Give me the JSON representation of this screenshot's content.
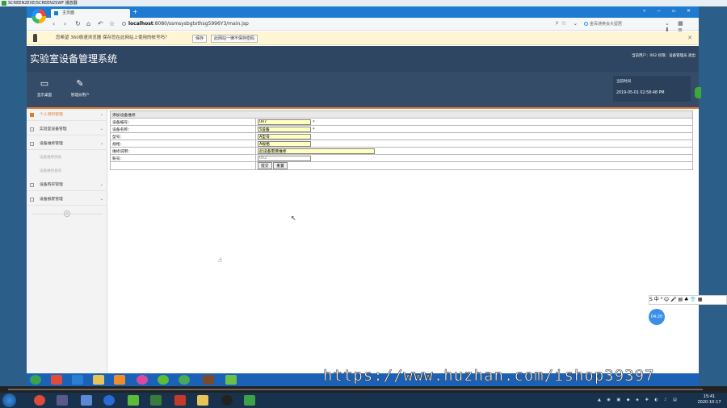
{
  "player": {
    "title": "SCREEN2EXE/SCREEN2SWF 播放器"
  },
  "browser": {
    "tab_title": "主页面",
    "new_tab": "+",
    "url_host": "localhost",
    "url_path": ":8080/ssmsysbgtxthsg5996Y3/main.jsp",
    "search_placeholder": "金百通英会大留居",
    "save_prompt": {
      "message": "您希望 360极速浏览器 保存您在此网站上使用的帐号吗？",
      "save_label": "保存",
      "never_label": "此网站一律不保存密码"
    }
  },
  "app": {
    "title": "实验室设备管理系统",
    "user_info": "当前用户：002 权限：设备管理员  退出",
    "toolbar": [
      {
        "label": "显示桌面"
      },
      {
        "label": "管理员用户"
      }
    ],
    "time_label": "当前时间",
    "time_value": "2019-05-01 02:58:48 PM"
  },
  "sidebar": {
    "items": [
      {
        "label": "个人资料管理",
        "active": true
      },
      {
        "label": "实验室设备管理"
      },
      {
        "label": "设备维修管理"
      },
      {
        "label": "设备维修添加",
        "sub": true
      },
      {
        "label": "设备维修查询",
        "sub": true
      },
      {
        "label": "设备购买管理"
      },
      {
        "label": "设备报废管理"
      }
    ],
    "collapse": "«"
  },
  "form": {
    "caption": "添加设备维修",
    "rows": [
      {
        "label": "设备编号：",
        "value": "007",
        "required": "*"
      },
      {
        "label": "设备名称：",
        "value": "S设备",
        "required": "*"
      },
      {
        "label": "型号：",
        "value": "A型号"
      },
      {
        "label": "规格：",
        "value": "A规格"
      },
      {
        "label": "维修说明：",
        "value": "此设备需要维修"
      },
      {
        "label": "账号：",
        "value": "002"
      }
    ],
    "submit_label": "提交",
    "reset_label": "重置"
  },
  "widgets": {
    "sogou": "S 中 ⁵ ☺ 🎤 ▤ ♣ 👕 ▦",
    "clock_bubble": "04:20"
  },
  "watermark": "https://www.huzhan.com/ishop39397",
  "taskbar": {
    "time": "15:41",
    "date": "2020-10-17"
  },
  "colors": {
    "header": "#2f4662",
    "accent": "#e07a2f",
    "browser_blue": "#1e7bd1",
    "input_yellow": "#ffffc0"
  }
}
